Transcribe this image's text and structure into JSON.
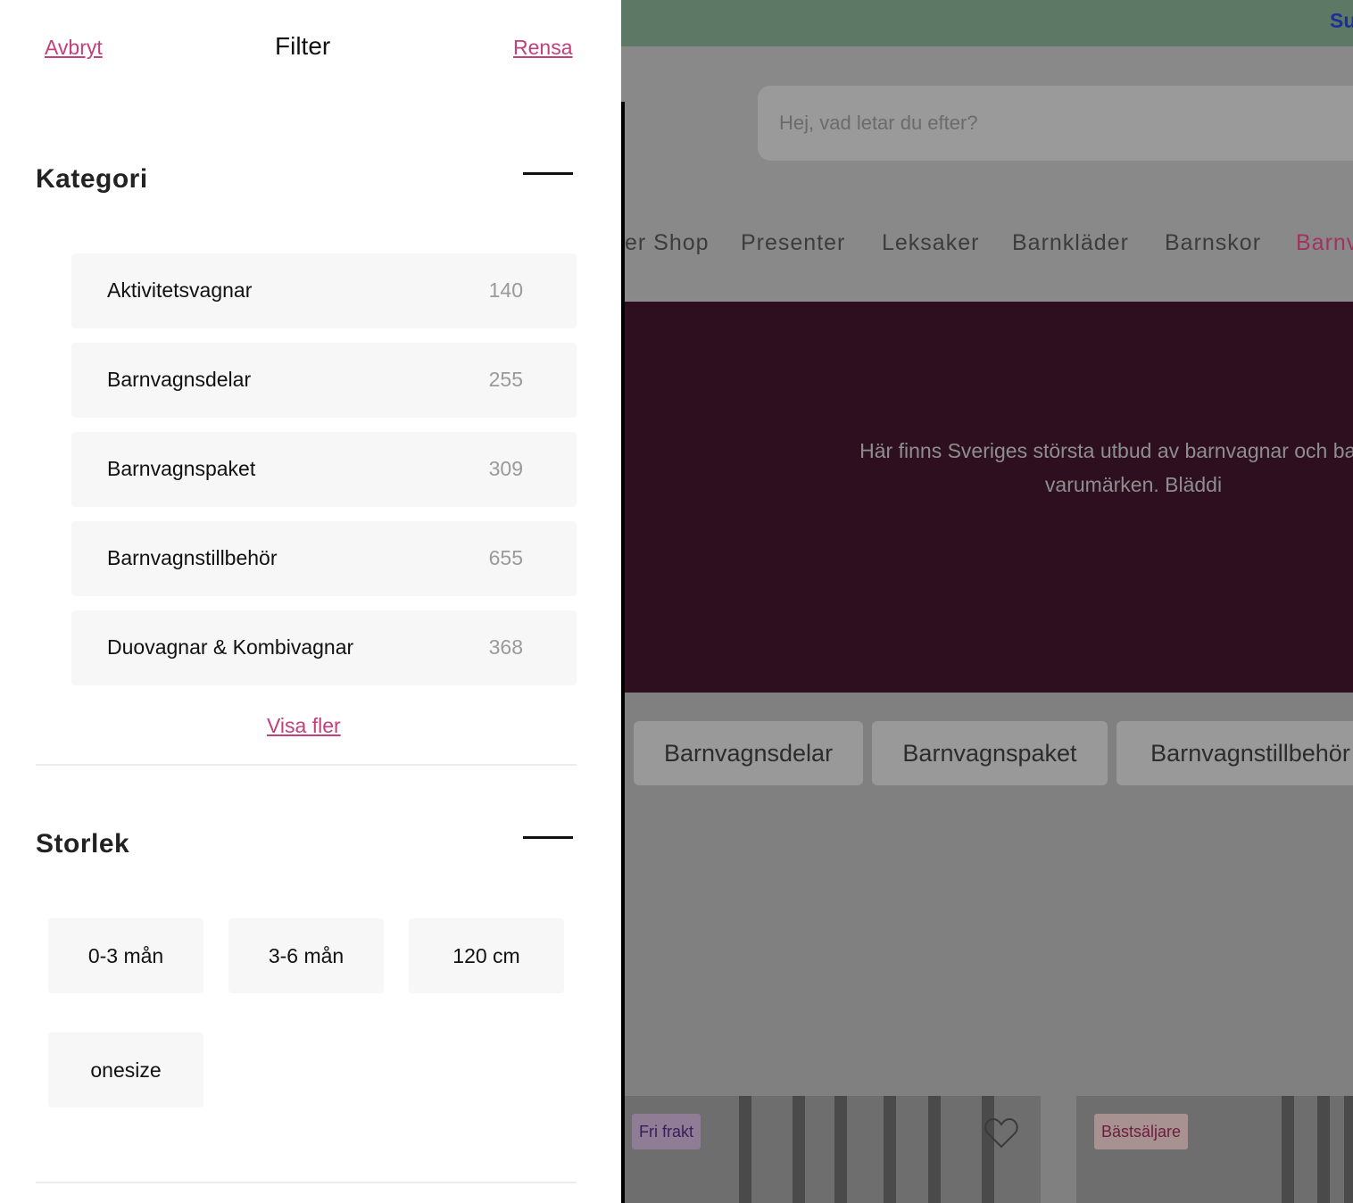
{
  "filter_panel": {
    "title": "Filter",
    "cancel_label": "Avbryt",
    "clear_label": "Rensa",
    "category_section": {
      "title": "Kategori",
      "items": [
        {
          "label": "Aktivitetsvagnar",
          "count": "140"
        },
        {
          "label": "Barnvagnsdelar",
          "count": "255"
        },
        {
          "label": "Barnvagnspaket",
          "count": "309"
        },
        {
          "label": "Barnvagnstillbehör",
          "count": "655"
        },
        {
          "label": "Duovagnar & Kombivagnar",
          "count": "368"
        }
      ],
      "show_more_label": "Visa fler"
    },
    "size_section": {
      "title": "Storlek",
      "options": [
        "0-3 mån",
        "3-6 mån",
        "120 cm",
        "onesize"
      ]
    }
  },
  "background_page": {
    "topbar_link": "Su",
    "search_placeholder": "Hej, vad letar du efter?",
    "nav_items": [
      "er Shop",
      "Presenter",
      "Leksaker",
      "Barnkläder",
      "Barnskor",
      "Barnv"
    ],
    "hero_text_lines": [
      "Här finns Sveriges största utbud av barnvagnar och barnvag",
      "varumärken. Bläddi"
    ],
    "category_chips": [
      "Barnvagnsdelar",
      "Barnvagnspaket",
      "Barnvagnstillbehör"
    ],
    "product_badges": [
      "Fri frakt",
      "Bästsäljare"
    ]
  },
  "colors": {
    "accent_pink": "#c2407b",
    "hero_bg": "#2e0f1f",
    "topbar_bg": "#5e7866",
    "overlay_gray": "#808080"
  }
}
